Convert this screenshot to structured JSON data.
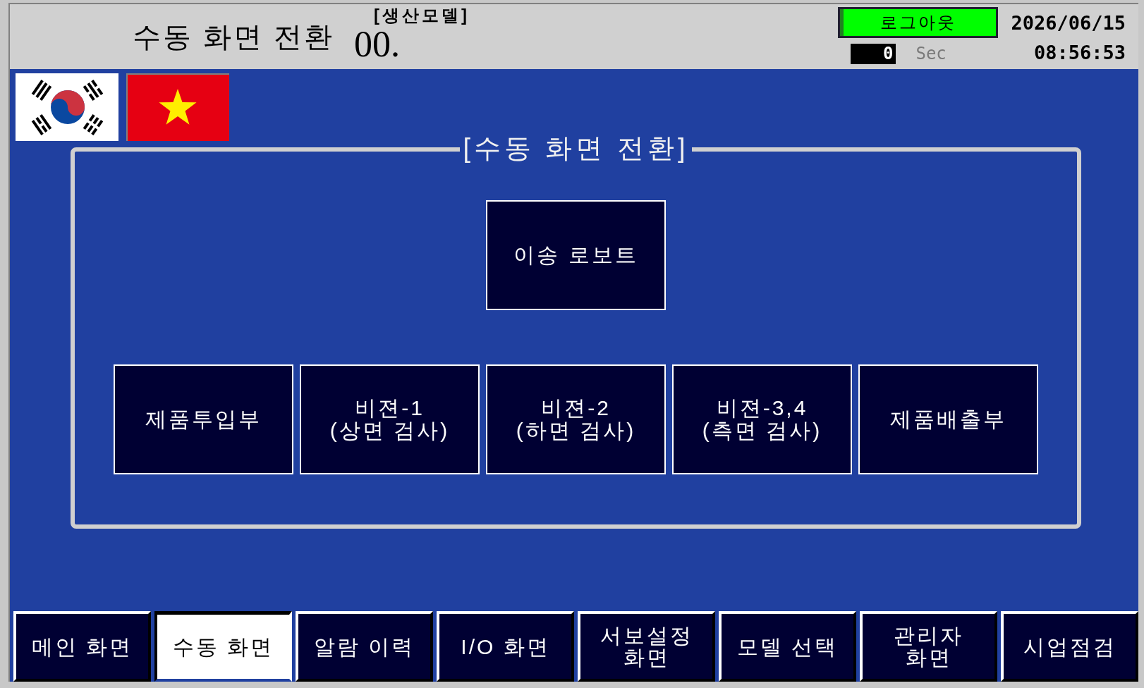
{
  "header": {
    "title": "수동 화면 전환",
    "model_label": "[생산모델]",
    "model_value": "00.",
    "logout_button": "로그아웃",
    "timer": {
      "value": "0",
      "unit": "Sec"
    },
    "date": "2026/06/15",
    "time": "08:56:53"
  },
  "panel": {
    "title": "[수동 화면 전환]",
    "top_button": {
      "label": "이송 로보트"
    },
    "buttons": [
      {
        "label": "제품투입부"
      },
      {
        "label": "비젼-1\n(상면 검사)"
      },
      {
        "label": "비젼-2\n(하면 검사)"
      },
      {
        "label": "비젼-3,4\n(측면 검사)"
      },
      {
        "label": "제품배출부"
      }
    ]
  },
  "tabs": [
    {
      "label": "메인 화면",
      "selected": false
    },
    {
      "label": "수동 화면",
      "selected": true
    },
    {
      "label": "알람 이력",
      "selected": false
    },
    {
      "label": "I/O 화면",
      "selected": false
    },
    {
      "label": "서보설정\n화면",
      "selected": false
    },
    {
      "label": "모델 선택",
      "selected": false
    },
    {
      "label": "관리자\n화면",
      "selected": false
    },
    {
      "label": "시업점검",
      "selected": false
    }
  ]
}
